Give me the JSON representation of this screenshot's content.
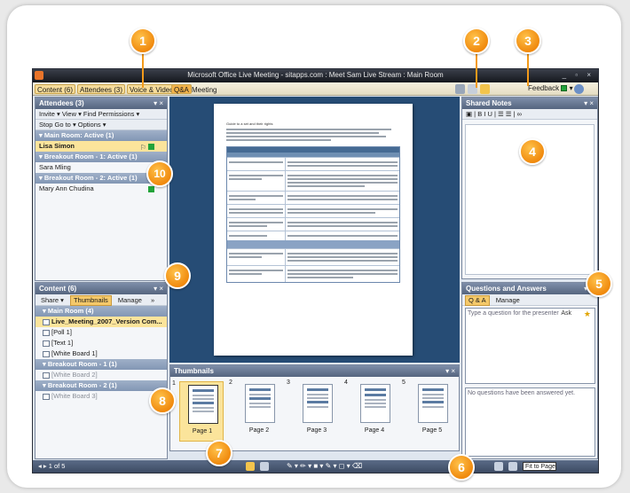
{
  "window": {
    "title": "Microsoft Office Live Meeting - sitapps.com : Meet Sam Live Stream : Main Room",
    "controls": "_ ▫ ×"
  },
  "menubar": {
    "items": [
      "Content (6)",
      "Attendees (3)",
      "Voice & Video",
      "Q&A",
      "Meeting"
    ],
    "feedback": "Feedback"
  },
  "attendees": {
    "header": "Attendees (3)",
    "toolbar1": "Invite ▾  View ▾  Find  Permissions ▾",
    "toolbar2": "Stop  Go to ▾  Options ▾",
    "rows": [
      {
        "text": "▾ Main Room: Active (1)",
        "kind": "grp"
      },
      {
        "text": "Lisa Simon",
        "kind": "sel"
      },
      {
        "text": "▾ Breakout Room - 1: Active (1)",
        "kind": "grp"
      },
      {
        "text": "Sara Mling",
        "kind": "plain"
      },
      {
        "text": "▾ Breakout Room - 2: Active (1)",
        "kind": "grp"
      },
      {
        "text": "Mary Ann Chudina",
        "kind": "plain"
      }
    ]
  },
  "content": {
    "header": "Content (6)",
    "tabs": [
      "Share ▾",
      "Thumbnails",
      "Manage",
      "»"
    ],
    "rows": [
      {
        "text": "▾ Main Room (4)",
        "kind": "grp"
      },
      {
        "text": "Live_Meeting_2007_Version Com...",
        "kind": "sel"
      },
      {
        "text": "[Poll 1]",
        "kind": "plain"
      },
      {
        "text": "[Text 1]",
        "kind": "plain"
      },
      {
        "text": "[White Board 1]",
        "kind": "plain"
      },
      {
        "text": "▾ Breakout Room - 1 (1)",
        "kind": "grp"
      },
      {
        "text": "[White Board 2]",
        "kind": "plain"
      },
      {
        "text": "▾ Breakout Room - 2 (1)",
        "kind": "grp"
      },
      {
        "text": "[White Board 3]",
        "kind": "plain"
      }
    ]
  },
  "document": {
    "heading": "Guide to a set and their rights"
  },
  "thumbnails": {
    "header": "Thumbnails",
    "pages": [
      {
        "num": "1",
        "label": "Page 1"
      },
      {
        "num": "2",
        "label": "Page 2"
      },
      {
        "num": "3",
        "label": "Page 3"
      },
      {
        "num": "4",
        "label": "Page 4"
      },
      {
        "num": "5",
        "label": "Page 5"
      }
    ]
  },
  "shared_notes": {
    "header": "Shared Notes",
    "toolbar": "▣ | B  I  U | ☰  ☰ | ∞"
  },
  "qa": {
    "header": "Questions and Answers",
    "tabs": [
      "Q & A",
      "Manage"
    ],
    "placeholder": "Type a question for the presenter",
    "ask": "Ask",
    "empty": "No questions have been answered yet."
  },
  "statusbar": {
    "left": "◂  ▸  1 of 5",
    "zoom": "Fit to Page"
  },
  "callouts": [
    "1",
    "2",
    "3",
    "4",
    "5",
    "6",
    "7",
    "8",
    "9",
    "10"
  ],
  "colors": {
    "callout": "#f08a0e",
    "stage": "#264c75",
    "panel_header": "#55657f"
  }
}
